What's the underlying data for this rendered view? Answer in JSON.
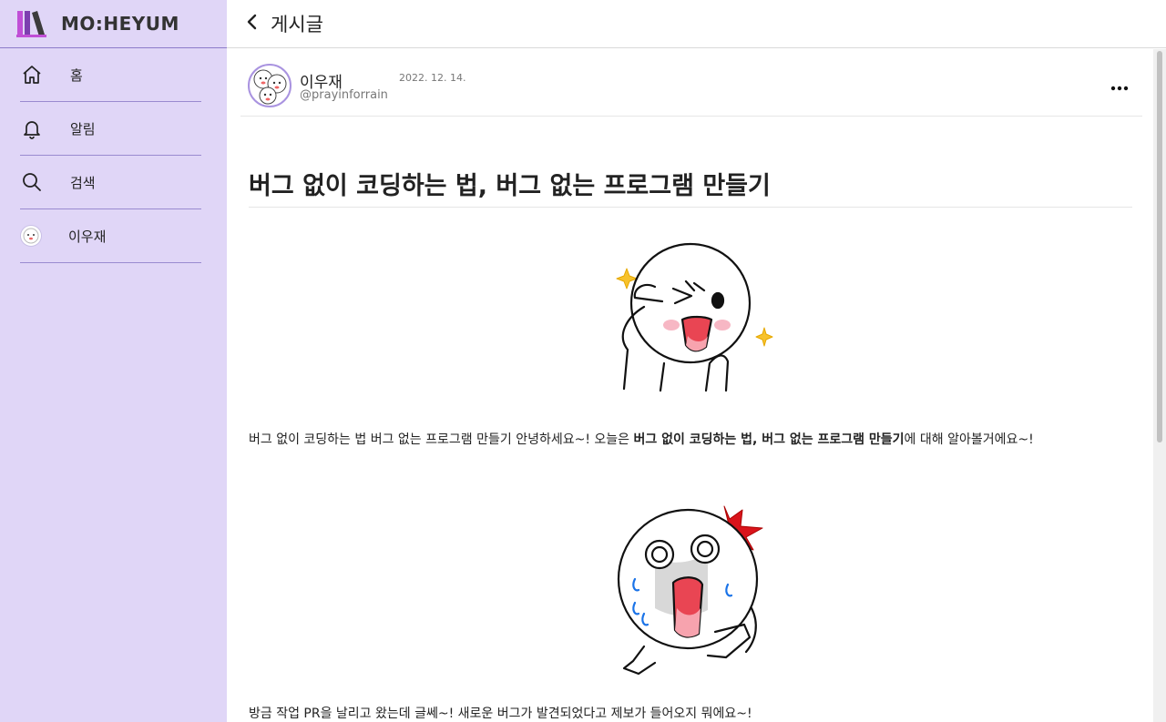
{
  "app": {
    "logo_text": "MO:HEYUM"
  },
  "sidebar": {
    "items": [
      {
        "label": "홈",
        "icon": "home-icon"
      },
      {
        "label": "알림",
        "icon": "bell-icon"
      },
      {
        "label": "검색",
        "icon": "search-icon"
      },
      {
        "label": "이우재",
        "icon": "avatar"
      }
    ]
  },
  "topbar": {
    "title": "게시글"
  },
  "post": {
    "author_name": "이우재",
    "author_handle": "@prayinforrain",
    "date": "2022. 12. 14.",
    "title": "버그 없이 코딩하는 법, 버그 없는 프로그램 만들기",
    "para1_prefix": "버그 없이 코딩하는 법 버그 없는 프로그램 만들기 안녕하세요~! 오늘은 ",
    "para1_bold": "버그 없이 코딩하는 법, 버그 없는 프로그램 만들기",
    "para1_suffix": "에 대해 알아볼거에요~!",
    "para2": "방금 작업 PR을 날리고 왔는데 글쎄~! 새로운 버그가 발견되었다고 제보가 들어오지 뭐에요~!"
  },
  "colors": {
    "sidebar_bg": "#e0d6f7",
    "accent": "#8c7cc9"
  }
}
